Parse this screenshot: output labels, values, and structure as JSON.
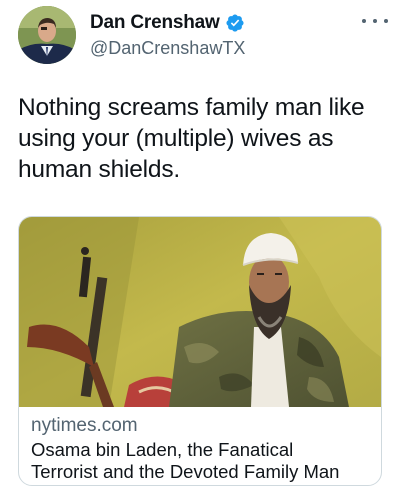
{
  "author": {
    "display_name": "Dan Crenshaw",
    "handle": "@DanCrenshawTX",
    "verified": true,
    "verified_color": "#1d9bf0"
  },
  "tweet": {
    "text": "Nothing screams family man like\nusing your (multiple) wives as\nhuman shields."
  },
  "link_card": {
    "domain": "nytimes.com",
    "title": "Osama bin Laden, the Fanatical\nTerrorist and the Devoted Family Man"
  },
  "icons": {
    "more": "more-options-icon",
    "verified": "verified-badge-icon"
  }
}
